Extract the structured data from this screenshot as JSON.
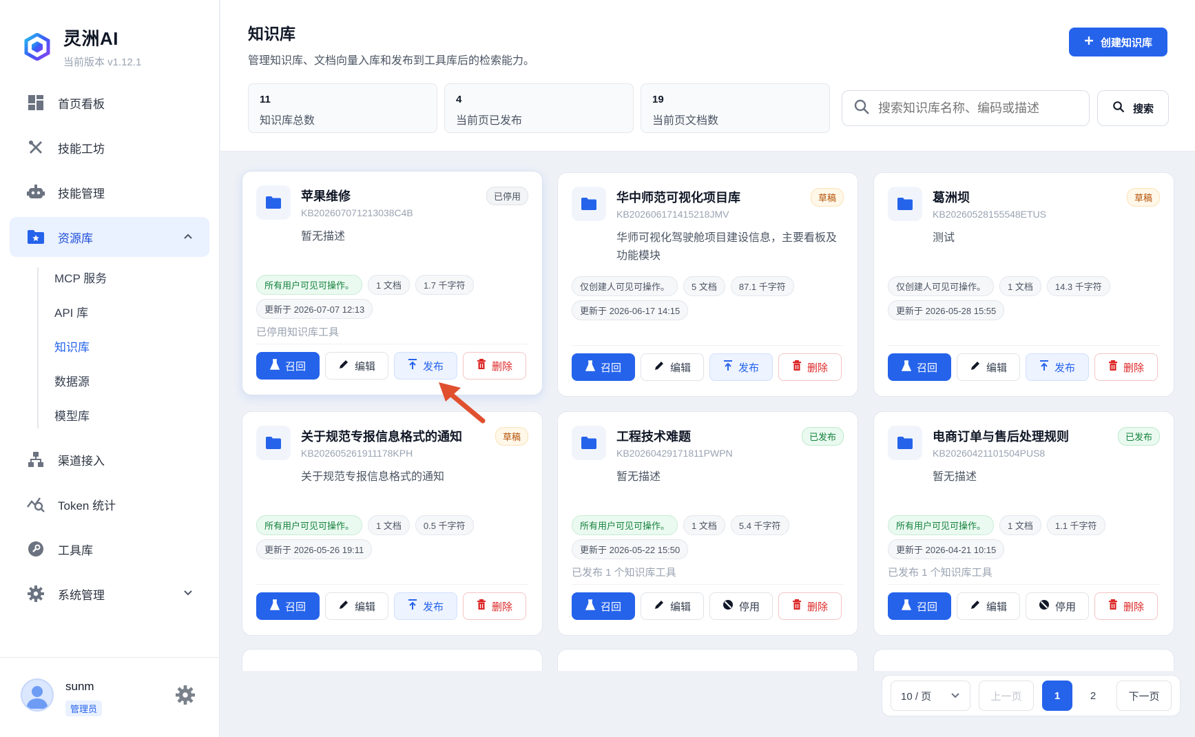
{
  "app": {
    "name": "灵洲AI",
    "version": "当前版本 v1.12.1"
  },
  "sidebar": {
    "items": [
      {
        "label": "首页看板"
      },
      {
        "label": "技能工坊"
      },
      {
        "label": "技能管理"
      },
      {
        "label": "资源库"
      },
      {
        "label": "渠道接入"
      },
      {
        "label": "Token 统计"
      },
      {
        "label": "工具库"
      },
      {
        "label": "系统管理"
      }
    ],
    "sub_items": [
      {
        "label": "MCP 服务"
      },
      {
        "label": "API 库"
      },
      {
        "label": "知识库"
      },
      {
        "label": "数据源"
      },
      {
        "label": "模型库"
      }
    ]
  },
  "user": {
    "name": "sunm",
    "role": "管理员"
  },
  "page": {
    "title": "知识库",
    "description": "管理知识库、文档向量入库和发布到工具库后的检索能力。",
    "create_label": "创建知识库"
  },
  "stats": [
    {
      "value": "11",
      "label": "知识库总数"
    },
    {
      "value": "4",
      "label": "当前页已发布"
    },
    {
      "value": "19",
      "label": "当前页文档数"
    }
  ],
  "search": {
    "placeholder": "搜索知识库名称、编码或描述",
    "button": "搜索"
  },
  "actions": {
    "recall": "召回",
    "edit": "编辑",
    "publish": "发布",
    "disable": "停用",
    "delete": "删除"
  },
  "cards": [
    {
      "title": "苹果维修",
      "code": "KB202607071213038C4B",
      "desc": "暂无描述",
      "badge": "已停用",
      "visibility": "所有用户可见可操作。",
      "docs": "1 文档",
      "chars": "1.7 千字符",
      "updated": "更新于 2026-07-07 12:13",
      "note": "已停用知识库工具"
    },
    {
      "title": "华中师范可视化项目库",
      "code": "KB202606171415218JMV",
      "desc": "华师可视化驾驶舱项目建设信息，主要看板及功能模块",
      "badge": "草稿",
      "visibility": "仅创建人可见可操作。",
      "docs": "5 文档",
      "chars": "87.1 千字符",
      "updated": "更新于 2026-06-17 14:15",
      "note": ""
    },
    {
      "title": "葛洲坝",
      "code": "KB20260528155548ETUS",
      "desc": "测试",
      "badge": "草稿",
      "visibility": "仅创建人可见可操作。",
      "docs": "1 文档",
      "chars": "14.3 千字符",
      "updated": "更新于 2026-05-28 15:55",
      "note": ""
    },
    {
      "title": "关于规范专报信息格式的通知",
      "code": "KB202605261911178KPH",
      "desc": "关于规范专报信息格式的通知",
      "badge": "草稿",
      "visibility": "所有用户可见可操作。",
      "docs": "1 文档",
      "chars": "0.5 千字符",
      "updated": "更新于 2026-05-26 19:11",
      "note": ""
    },
    {
      "title": "工程技术难题",
      "code": "KB20260429171811PWPN",
      "desc": "暂无描述",
      "badge": "已发布",
      "visibility": "所有用户可见可操作。",
      "docs": "1 文档",
      "chars": "5.4 千字符",
      "updated": "更新于 2026-05-22 15:50",
      "note": "已发布 1 个知识库工具"
    },
    {
      "title": "电商订单与售后处理规则",
      "code": "KB20260421101504PUS8",
      "desc": "暂无描述",
      "badge": "已发布",
      "visibility": "所有用户可见可操作。",
      "docs": "1 文档",
      "chars": "1.1 千字符",
      "updated": "更新于 2026-04-21 10:15",
      "note": "已发布 1 个知识库工具"
    }
  ],
  "pagination": {
    "page_size": "10 / 页",
    "prev": "上一页",
    "pages": [
      "1",
      "2"
    ],
    "next": "下一页"
  }
}
